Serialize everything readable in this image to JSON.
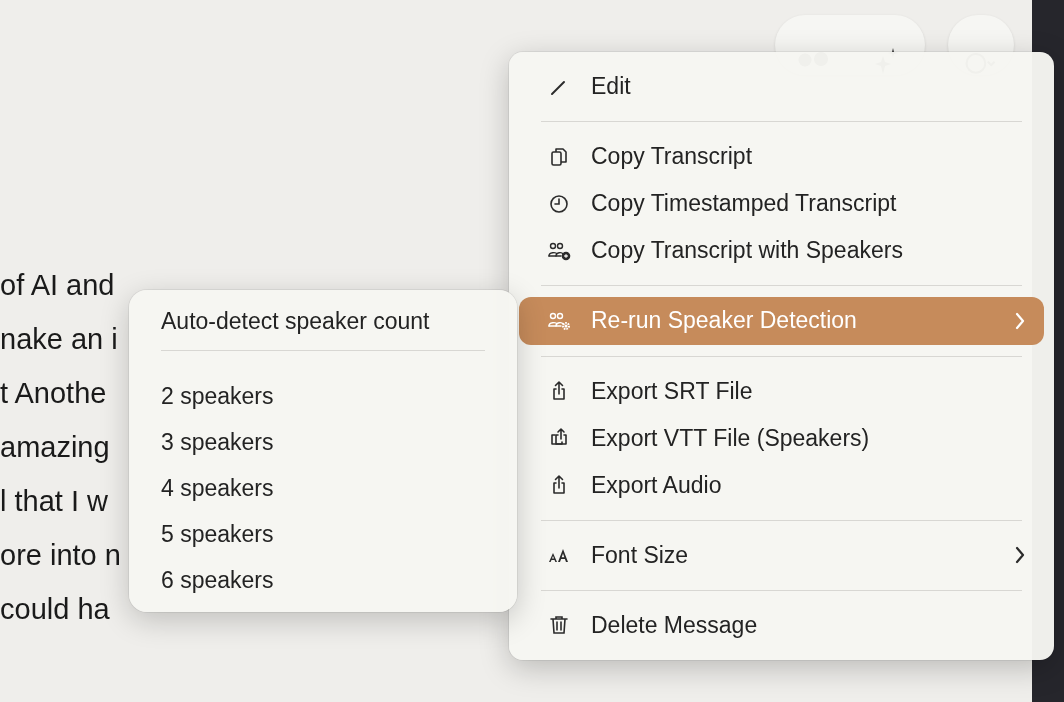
{
  "transcript_lines": [
    "of AI and",
    "nake an i",
    "t Anothe",
    "amazing",
    "l that I w",
    "ore into n",
    "could ha"
  ],
  "toolbar": {
    "buttons": [
      {
        "kind": "dots"
      },
      {
        "kind": "sparkle"
      },
      {
        "kind": "chat"
      }
    ]
  },
  "menu": {
    "groups": [
      [
        {
          "kind": "pencil",
          "label": "Edit",
          "submenu": false,
          "selected": false
        }
      ],
      [
        {
          "kind": "copy",
          "label": "Copy Transcript",
          "submenu": false,
          "selected": false
        },
        {
          "kind": "clock",
          "label": "Copy Timestamped Transcript",
          "submenu": false,
          "selected": false
        },
        {
          "kind": "people-plus",
          "label": "Copy Transcript with Speakers",
          "submenu": false,
          "selected": false
        }
      ],
      [
        {
          "kind": "people-gear",
          "label": "Re-run Speaker Detection",
          "submenu": true,
          "selected": true
        }
      ],
      [
        {
          "kind": "share",
          "label": "Export SRT File",
          "submenu": false,
          "selected": false
        },
        {
          "kind": "share-stack",
          "label": "Export VTT File (Speakers)",
          "submenu": false,
          "selected": false
        },
        {
          "kind": "share",
          "label": "Export Audio",
          "submenu": false,
          "selected": false
        }
      ],
      [
        {
          "kind": "font",
          "label": "Font Size",
          "submenu": true,
          "selected": false
        }
      ],
      [
        {
          "kind": "trash",
          "label": "Delete Message",
          "submenu": false,
          "selected": false
        }
      ]
    ]
  },
  "submenu": {
    "groups": [
      [
        "Auto-detect speaker count"
      ],
      [
        "2 speakers",
        "3 speakers",
        "4 speakers",
        "5 speakers",
        "6 speakers"
      ]
    ]
  }
}
